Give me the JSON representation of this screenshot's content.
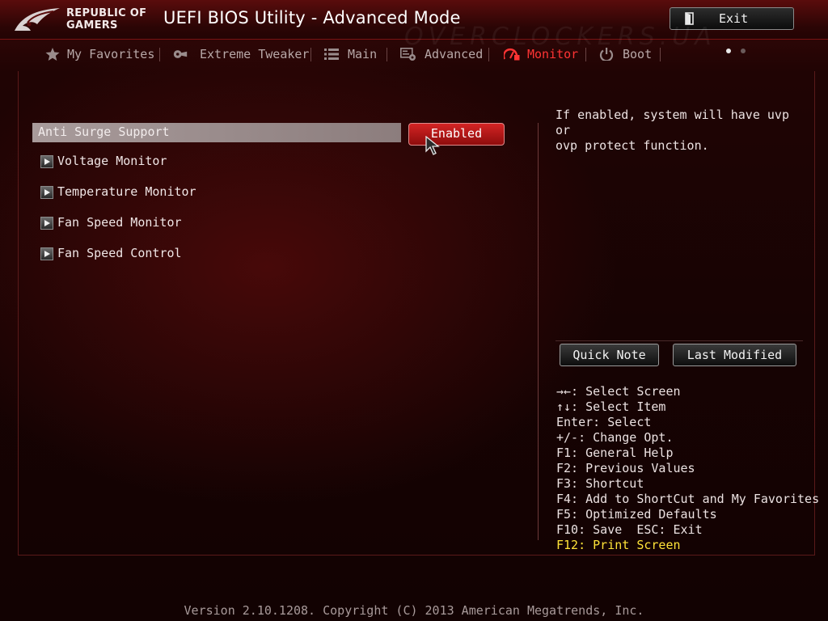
{
  "header": {
    "logo_line1": "REPUBLIC OF",
    "logo_line2": "GAMERS",
    "title": "UEFI BIOS Utility - Advanced Mode",
    "exit_label": "Exit",
    "watermark": "OVERCLOCKERS.UA"
  },
  "tabs": [
    {
      "label": "My Favorites",
      "icon": "star-icon"
    },
    {
      "label": "Extreme Tweaker",
      "icon": "tweaker-icon"
    },
    {
      "label": "Main",
      "icon": "list-icon"
    },
    {
      "label": "Advanced",
      "icon": "advanced-icon"
    },
    {
      "label": "Monitor",
      "icon": "monitor-icon",
      "active": true
    },
    {
      "label": "Boot",
      "icon": "power-icon"
    }
  ],
  "settings": {
    "anti_surge": {
      "label": "Anti Surge Support",
      "value": "Enabled"
    },
    "submenus": [
      "Voltage Monitor",
      "Temperature Monitor",
      "Fan Speed Monitor",
      "Fan Speed Control"
    ]
  },
  "help": {
    "line1": "If enabled, system will have uvp or",
    "line2": "ovp protect function."
  },
  "side_buttons": {
    "quick_note": "Quick Note",
    "last_modified": "Last Modified"
  },
  "keys": [
    "→←: Select Screen",
    "↑↓: Select Item",
    "Enter: Select",
    "+/-: Change Opt.",
    "F1: General Help",
    "F2: Previous Values",
    "F3: Shortcut",
    "F4: Add to ShortCut and My Favorites",
    "F5: Optimized Defaults",
    "F10: Save  ESC: Exit",
    "F12: Print Screen"
  ],
  "footer": {
    "version": "Version 2.10.1208. Copyright (C) 2013 American Megatrends, Inc."
  },
  "colors": {
    "accent": "#ff3434",
    "highlight_key": "#ffe338",
    "value_button": "#c81a1a"
  }
}
